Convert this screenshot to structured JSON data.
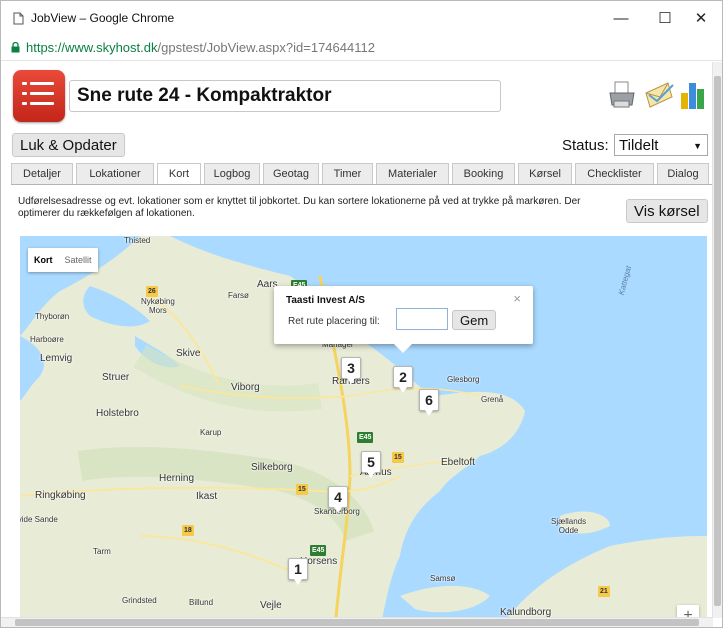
{
  "window": {
    "title": "JobView – Google Chrome",
    "url_scheme_host": "https://www.skyhost.dk",
    "url_path": "/gpstest/JobView.aspx?id=174644112",
    "controls": {
      "minimize": "—",
      "maximize": "☐",
      "close": "✕"
    }
  },
  "header": {
    "job_title": "Sne rute 24 - Kompaktraktor"
  },
  "toolbar": {
    "refresh_label": "Luk & Opdater",
    "status_label": "Status:",
    "status_value": "Tildelt"
  },
  "tabs": [
    {
      "label": "Detaljer",
      "w": 62
    },
    {
      "label": "Lokationer",
      "w": 78
    },
    {
      "label": "Kort",
      "w": 44
    },
    {
      "label": "Logbog",
      "w": 56
    },
    {
      "label": "Geotag",
      "w": 56
    },
    {
      "label": "Timer",
      "w": 51
    },
    {
      "label": "Materialer",
      "w": 73
    },
    {
      "label": "Booking",
      "w": 63
    },
    {
      "label": "Kørsel",
      "w": 54
    },
    {
      "label": "Checklister",
      "w": 79
    },
    {
      "label": "Dialog",
      "w": 52
    }
  ],
  "active_tab": "Kort",
  "map_section": {
    "description": "Udførelsesadresse og evt. lokationer som er knyttet til jobkortet. Du kan sortere lokationerne på ved at trykke på markøren. Der optimerer du rækkefølgen af lokationen.",
    "show_driving_label": "Vis kørsel",
    "map_type": {
      "map_label": "Kort",
      "satellite_label": "Satellit"
    },
    "popup": {
      "title": "Taasti Invest A/S",
      "close": "×",
      "field_label": "Ret rute placering til:",
      "field_value": "",
      "save_label": "Gem"
    },
    "markers": [
      "1",
      "2",
      "3",
      "4",
      "5",
      "6"
    ],
    "zoom_in": "+",
    "places": {
      "nykobing": "Nykøbing\nMors",
      "farso": "Farsø",
      "aars": "Aars",
      "thyboron": "Thyborøn",
      "harboore": "Harboøre",
      "lemvig": "Lemvig",
      "struer": "Struer",
      "skive": "Skive",
      "viborg": "Viborg",
      "randers": "Randers",
      "glesborg": "Glesborg",
      "grena": "Grenå",
      "holstebro": "Holstebro",
      "karup": "Karup",
      "herning": "Herning",
      "ikast": "Ikast",
      "silkeborg": "Silkeborg",
      "aarhus": "Aarhus",
      "ebeltoft": "Ebeltoft",
      "ringkobing": "Ringkøbing",
      "skanderborg": "Skanderborg",
      "sande": "lvide Sande",
      "tarm": "Tarm",
      "horsens": "Horsens",
      "samso": "Samsø",
      "grindsted": "Grindsted",
      "billund": "Billund",
      "vejle": "Vejle",
      "kalundborg": "Kalundborg",
      "sjaellands_odde": "Sjællands\nOdde",
      "kattegat": "Kattegat",
      "thisted": "Thisted",
      "mariager": "Mariager"
    },
    "roads": {
      "e45": "E45",
      "r26": "26",
      "r15": "15",
      "r18": "18",
      "r21": "21"
    }
  }
}
